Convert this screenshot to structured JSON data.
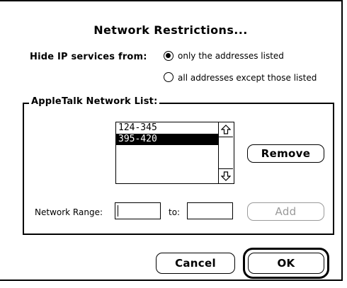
{
  "dialog": {
    "title": "Network Restrictions...",
    "hide_label": "Hide IP services from:",
    "options": [
      {
        "label": "only the addresses listed",
        "selected": true
      },
      {
        "label": "all addresses except those listed",
        "selected": false
      }
    ]
  },
  "group": {
    "legend": "AppleTalk Network List:",
    "list_items": [
      {
        "label": "124-345",
        "selected": false
      },
      {
        "label": "395-420",
        "selected": true
      }
    ],
    "remove_label": "Remove",
    "range_label": "Network Range:",
    "range_from": "",
    "to_label": "to:",
    "range_to": "",
    "add_label": "Add"
  },
  "buttons": {
    "cancel_label": "Cancel",
    "ok_label": "OK"
  }
}
